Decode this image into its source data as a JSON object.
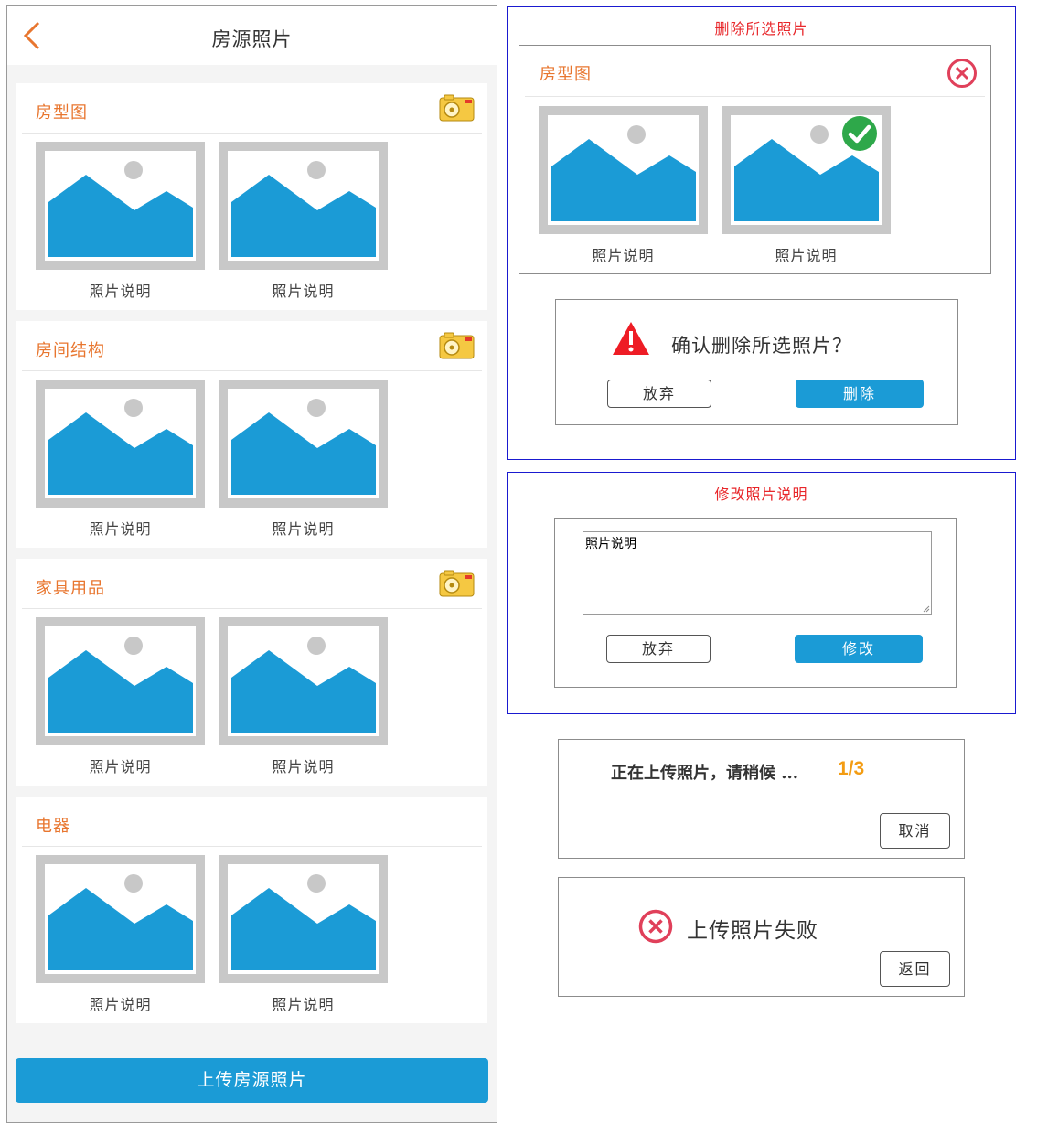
{
  "phone": {
    "title": "房源照片",
    "sections": [
      {
        "title": "房型图",
        "captions": [
          "照片说明",
          "照片说明"
        ],
        "has_camera": true
      },
      {
        "title": "房间结构",
        "captions": [
          "照片说明",
          "照片说明"
        ],
        "has_camera": true
      },
      {
        "title": "家具用品",
        "captions": [
          "照片说明",
          "照片说明"
        ],
        "has_camera": true
      },
      {
        "title": "电器",
        "captions": [
          "照片说明",
          "照片说明"
        ],
        "has_camera": false
      }
    ],
    "upload_label": "上传房源照片"
  },
  "delete_panel": {
    "label": "删除所选照片",
    "section_title": "房型图",
    "captions": [
      "照片说明",
      "照片说明"
    ],
    "confirm_text": "确认删除所选照片？",
    "cancel_label": "放弃",
    "delete_label": "删除"
  },
  "edit_panel": {
    "label": "修改照片说明",
    "textarea_value": "照片说明",
    "cancel_label": "放弃",
    "confirm_label": "修改"
  },
  "progress_dialog": {
    "text": "正在上传照片，请稍候 ...",
    "progress": "1/3",
    "cancel_label": "取消"
  },
  "fail_dialog": {
    "text": "上传照片失败",
    "back_label": "返回"
  },
  "colors": {
    "accent_orange": "#e8762f",
    "primary_blue": "#1b9bd6",
    "panel_label_red": "#e8262a",
    "panel_border_blue": "#1a1ad0",
    "error_red": "#e0405a",
    "progress_orange": "#f39c12"
  }
}
